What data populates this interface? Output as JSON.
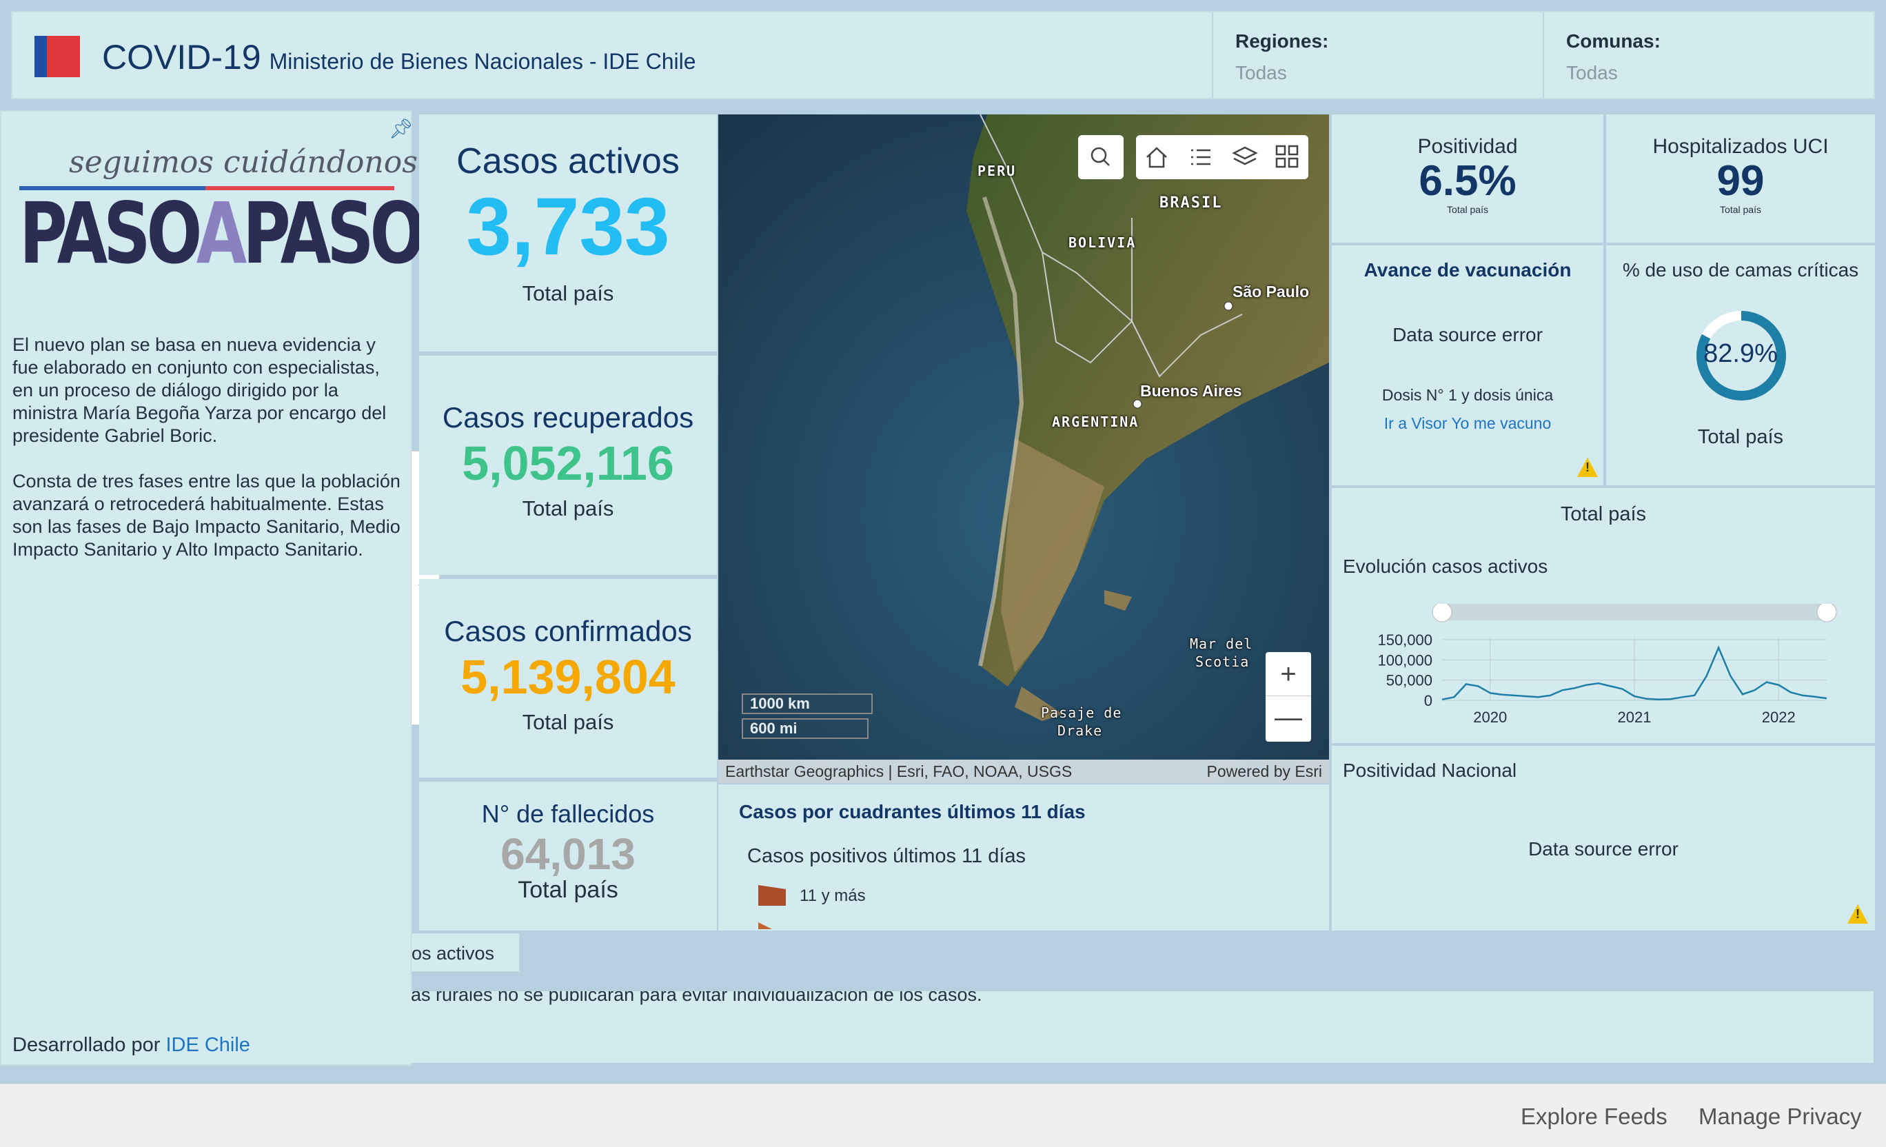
{
  "header": {
    "title": "COVID-19",
    "subtitle": "Ministerio de Bienes Nacionales - IDE Chile",
    "filters": [
      {
        "label": "Regiones:",
        "value": "Todas"
      },
      {
        "label": "Comunas:",
        "value": "Todas"
      }
    ]
  },
  "sidebar": {
    "logo_tagline": "seguimos cuidándonos",
    "logo_word1": "PASO",
    "logo_word2": "A",
    "logo_word3": "PASO",
    "paragraph1": "El nuevo plan se basa en nueva evidencia y fue elaborado en conjunto con especialistas, en un proceso de diálogo dirigido por la ministra María Begoña Yarza por encargo del presidente Gabriel Boric.",
    "paragraph2": "Consta de tres fases entre las que la población avanzará o retrocederá habitualmente. Estas son las fases de Bajo Impacto Sanitario, Medio Impacto Sanitario y Alto Impacto Sanitario.",
    "dev_prefix": "Desarrollado por ",
    "dev_link": "IDE Chile"
  },
  "stats": {
    "activos": {
      "title": "Casos activos",
      "value": "3,733",
      "sub": "Total país",
      "color": "#22bdf2"
    },
    "recuperados": {
      "title": "Casos recuperados",
      "value": "5,052,116",
      "sub": "Total país",
      "color": "#3ec48a"
    },
    "confirmados": {
      "title": "Casos confirmados",
      "value": "5,139,804",
      "sub": "Total país",
      "color": "#f5a800"
    },
    "fallecidos": {
      "title": "N° de fallecidos",
      "value": "64,013",
      "sub": "Total país",
      "color": "#a7a7a7"
    }
  },
  "map": {
    "labels": {
      "peru": "PERU",
      "brasil": "BRASIL",
      "bolivia": "BOLIVIA",
      "argentina": "ARGENTINA",
      "sao_paulo": "São Paulo",
      "buenos_aires": "Buenos Aires",
      "mar_scotia_1": "Mar del",
      "mar_scotia_2": "Scotia",
      "drake_1": "Pasaje de",
      "drake_2": "Drake"
    },
    "scale_km": "1000 km",
    "scale_mi": "600 mi",
    "attribution": "Earthstar Geographics | Esri, FAO, NOAA, USGS",
    "powered": "Powered by Esri"
  },
  "legend": {
    "title": "Casos por cuadrantes últimos 11 días",
    "subtitle": "Casos positivos últimos 11 días",
    "item1": "11 y más",
    "item1_color": "#a94d2a"
  },
  "kpis": {
    "positividad": {
      "title": "Positividad",
      "value": "6.5%",
      "sub": "Total país"
    },
    "uci": {
      "title": "Hospitalizados UCI",
      "value": "99",
      "sub": "Total país"
    },
    "vacunacion": {
      "title": "Avance de vacunación",
      "error": "Data source error",
      "dosis": "Dosis N° 1 y dosis única",
      "link": "Ir a Visor Yo me vacuno"
    },
    "camas": {
      "title": "% de uso de camas críticas",
      "value": "82.9%",
      "sub": "Total país",
      "fraction": 0.829,
      "color": "#1d7ea6"
    }
  },
  "evolucion": {
    "header": "Total país",
    "title": "Evolución casos activos"
  },
  "positividad_nacional": {
    "title": "Positividad Nacional",
    "error": "Data source error"
  },
  "tabs": {
    "active_tab": "os activos"
  },
  "note": "as rurales no se publicarán para evitar individualización de los casos.",
  "footer": {
    "explore": "Explore Feeds",
    "privacy": "Manage Privacy"
  },
  "chart_data": {
    "type": "line",
    "title": "Evolución casos activos",
    "xlabel": "",
    "ylabel": "",
    "x_ticks": [
      "2020",
      "2021",
      "2022"
    ],
    "y_ticks": [
      "150,000",
      "100,000",
      "50,000",
      "0"
    ],
    "ylim": [
      0,
      160000
    ],
    "xlim": [
      "2020-03",
      "2022-11"
    ],
    "grid": true,
    "series": [
      {
        "color": "#1d7ea6",
        "x": [
          "2020-03",
          "2020-04",
          "2020-05",
          "2020-06",
          "2020-07",
          "2020-08",
          "2020-09",
          "2020-10",
          "2020-11",
          "2020-12",
          "2021-01",
          "2021-02",
          "2021-03",
          "2021-04",
          "2021-05",
          "2021-06",
          "2021-07",
          "2021-08",
          "2021-09",
          "2021-10",
          "2021-11",
          "2021-12",
          "2022-01",
          "2022-02",
          "2022-03",
          "2022-04",
          "2022-05",
          "2022-06",
          "2022-07",
          "2022-08",
          "2022-09",
          "2022-10",
          "2022-11"
        ],
        "y": [
          2000,
          8000,
          40000,
          35000,
          18000,
          14000,
          12000,
          10000,
          8000,
          12000,
          25000,
          30000,
          38000,
          42000,
          35000,
          28000,
          10000,
          4000,
          2000,
          3000,
          8000,
          12000,
          60000,
          130000,
          60000,
          15000,
          25000,
          45000,
          38000,
          20000,
          12000,
          9000,
          5000
        ]
      }
    ]
  }
}
